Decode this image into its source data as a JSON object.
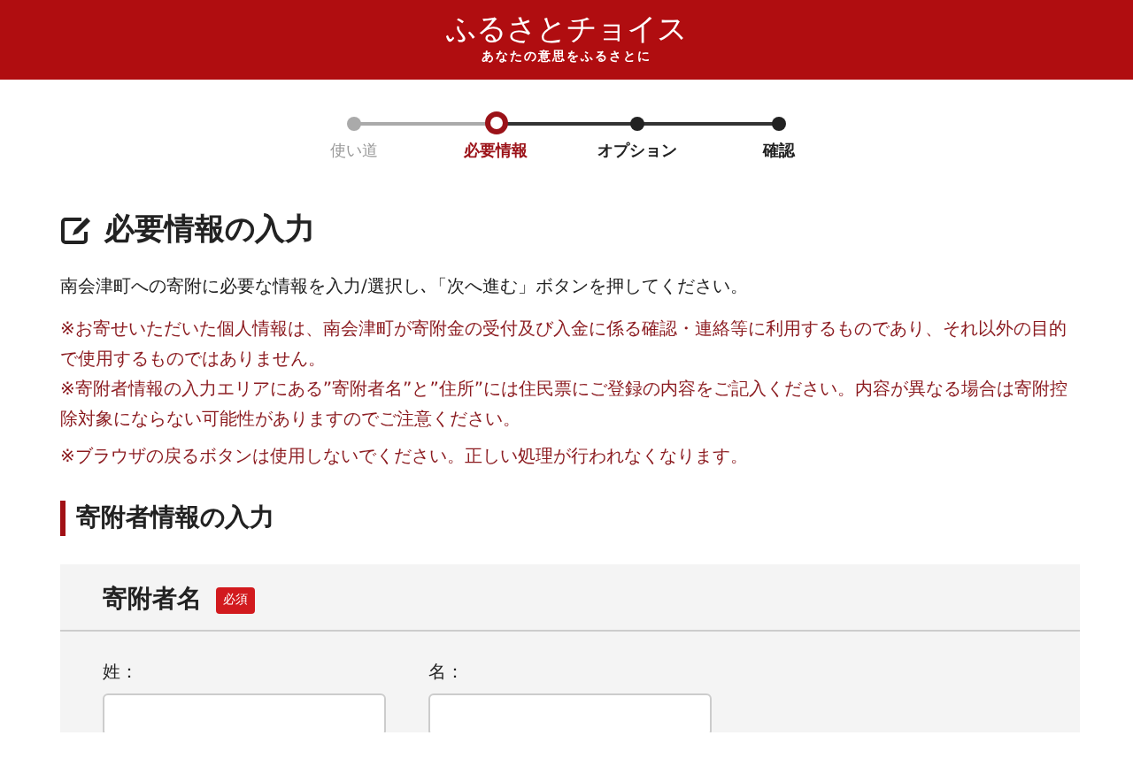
{
  "header": {
    "logo": "ふるさとチョイス",
    "tagline": "あなたの意思をふるさとに"
  },
  "steps": [
    {
      "label": "使い道",
      "completed": true,
      "selected": false
    },
    {
      "label": "必要情報",
      "completed": false,
      "selected": true
    },
    {
      "label": "オプション",
      "completed": false,
      "selected": false
    },
    {
      "label": "確認",
      "completed": false,
      "selected": false
    }
  ],
  "page_title": "必要情報の入力",
  "intro": "南会津町への寄附に必要な情報を入力/選択し､「次へ進む」ボタンを押してください。",
  "notes": [
    "※お寄せいただいた個人情報は、南会津町が寄附金の受付及び入金に係る確認・連絡等に利用するものであり、それ以外の目的で使用するものではありません。",
    "※寄附者情報の入力エリアにある”寄附者名”と”住所”には住民票にご登録の内容をご記入ください。内容が異なる場合は寄附控除対象にならない可能性がありますのでご注意ください。",
    "※ブラウザの戻るボタンは使用しないでください。正しい処理が行われなくなります。"
  ],
  "section_title": "寄附者情報の入力",
  "form": {
    "title": "寄附者名",
    "required_badge": "必須",
    "fields": [
      {
        "label": "姓："
      },
      {
        "label": "名："
      }
    ]
  }
}
